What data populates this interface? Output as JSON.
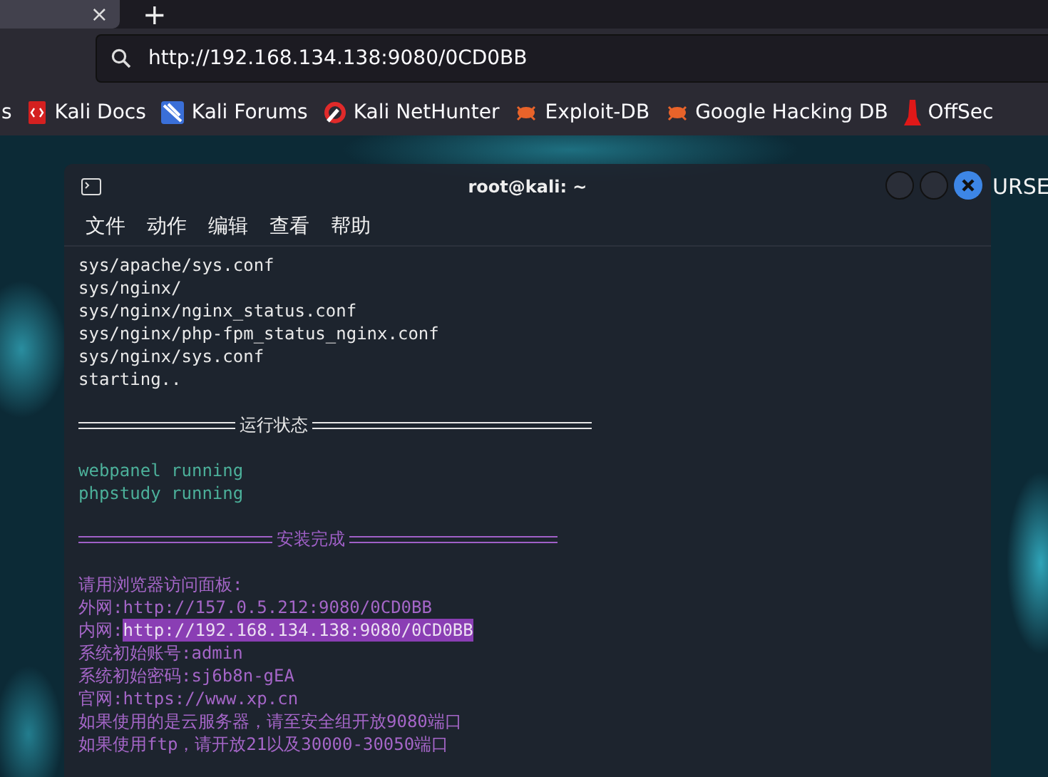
{
  "browser": {
    "tab_close": "×",
    "new_tab": "+",
    "url": "http://192.168.134.138:9080/0CD0BB",
    "bookmarks": [
      {
        "label": "s",
        "kind": "plain"
      },
      {
        "label": "Kali Docs",
        "kind": "docs"
      },
      {
        "label": "Kali Forums",
        "kind": "forums"
      },
      {
        "label": "Kali NetHunter",
        "kind": "nethunter"
      },
      {
        "label": "Exploit-DB",
        "kind": "bug"
      },
      {
        "label": "Google Hacking DB",
        "kind": "bug"
      },
      {
        "label": "OffSec",
        "kind": "offsec"
      }
    ]
  },
  "website": {
    "nav": [
      "URSE"
    ]
  },
  "terminal": {
    "title": "root@kali: ~",
    "menu": [
      "文件",
      "动作",
      "编辑",
      "查看",
      "帮助"
    ],
    "lines": [
      {
        "kind": "plain",
        "text": "sys/apache/sys.conf"
      },
      {
        "kind": "plain",
        "text": "sys/nginx/"
      },
      {
        "kind": "plain",
        "text": "sys/nginx/nginx_status.conf"
      },
      {
        "kind": "plain",
        "text": "sys/nginx/php-fpm_status_nginx.conf"
      },
      {
        "kind": "plain",
        "text": "sys/nginx/sys.conf"
      },
      {
        "kind": "plain",
        "text": "starting.."
      },
      {
        "kind": "blank"
      },
      {
        "kind": "divider",
        "text": "运行状态",
        "color": "#e6e6e6"
      },
      {
        "kind": "blank"
      },
      {
        "kind": "status",
        "text": "webpanel running"
      },
      {
        "kind": "status",
        "text": "phpstudy running"
      },
      {
        "kind": "blank"
      },
      {
        "kind": "divider",
        "text": "安装完成",
        "color": "#a060c8"
      },
      {
        "kind": "blank"
      },
      {
        "kind": "info",
        "text": "请用浏览器访问面板:"
      },
      {
        "kind": "info",
        "text": "外网:http://157.0.5.212:9080/0CD0BB"
      },
      {
        "kind": "info",
        "text": "内网:",
        "selection": "http://192.168.134.138:9080/0CD0BB"
      },
      {
        "kind": "info",
        "text": "系统初始账号:admin"
      },
      {
        "kind": "info",
        "text": "系统初始密码:sj6b8n-gEA"
      },
      {
        "kind": "info",
        "text": "官网:https://www.xp.cn"
      },
      {
        "kind": "info",
        "text": "如果使用的是云服务器，请至安全组开放9080端口"
      },
      {
        "kind": "info",
        "text": "如果使用ftp，请开放21以及30000-30050端口"
      }
    ]
  }
}
